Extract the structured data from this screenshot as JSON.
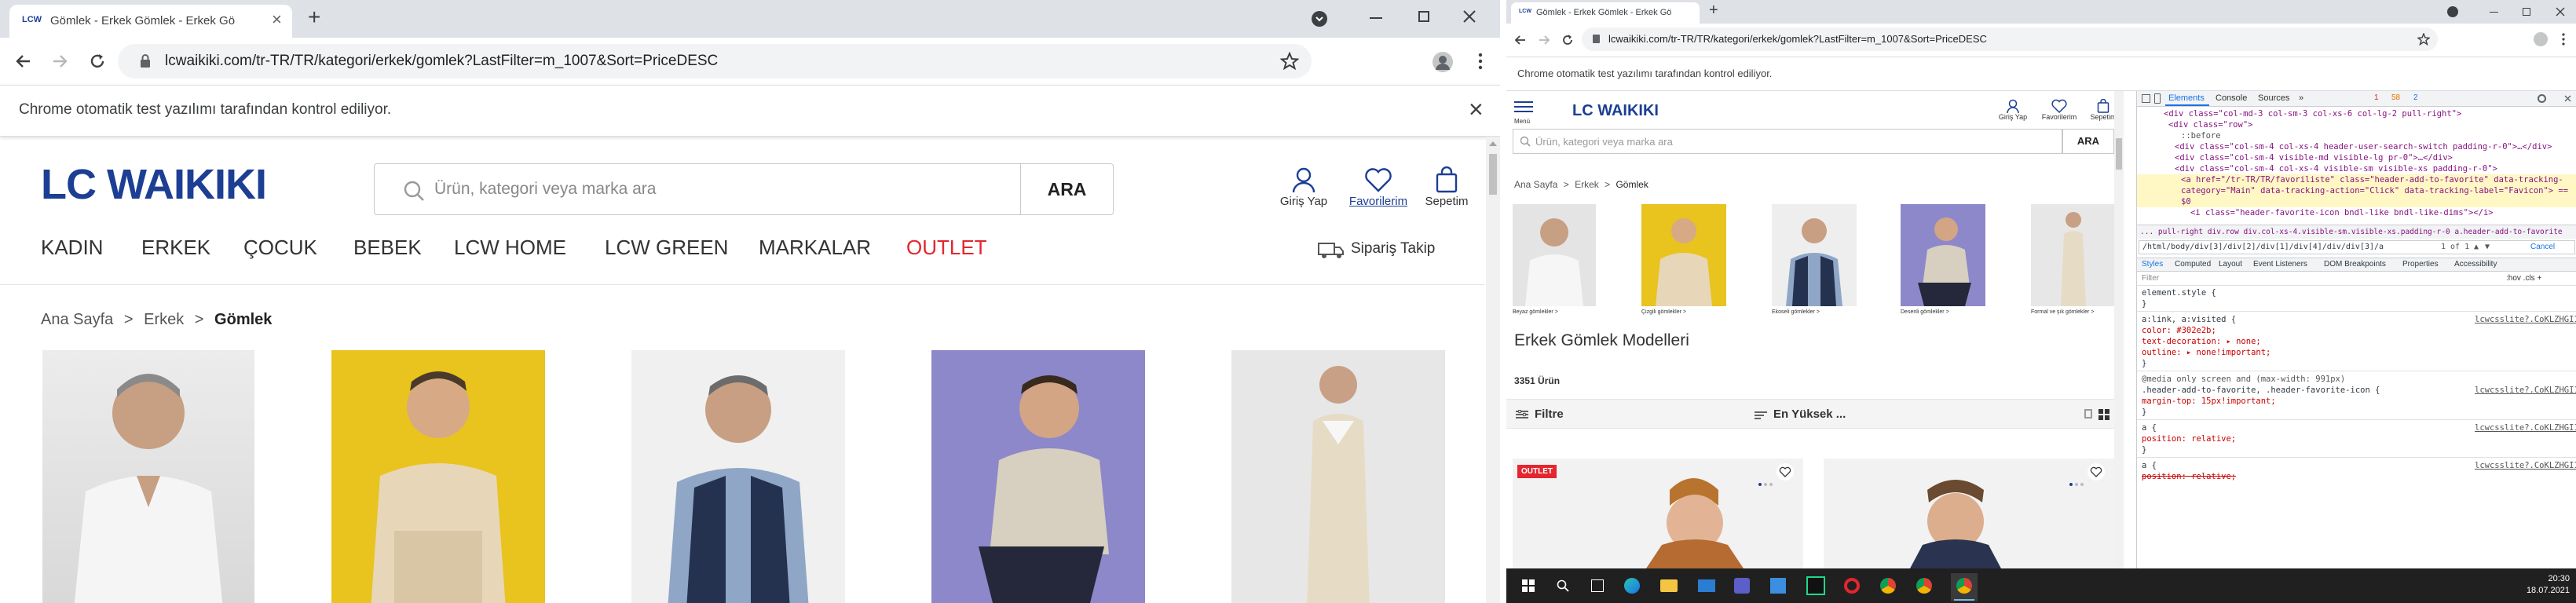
{
  "left_browser": {
    "tab_title": "Gömlek - Erkek Gömlek - Erkek Gö",
    "favicon_text": "LCW",
    "new_tab_symbol": "+",
    "url": "lcwaikiki.com/tr-TR/TR/kategori/erkek/gomlek?LastFilter=m_1007&Sort=PriceDESC",
    "infobar_text": "Chrome otomatik test yazılımı tarafından kontrol ediliyor.",
    "close_symbol": "×"
  },
  "left_page": {
    "logo": "LC WAIKIKI",
    "search_placeholder": "Ürün, kategori veya marka ara",
    "search_button": "ARA",
    "header_icons": [
      {
        "label": "Giriş Yap",
        "icon": "user-icon"
      },
      {
        "label": "Favorilerim",
        "icon": "heart-icon"
      },
      {
        "label": "Sepetim",
        "icon": "bag-icon"
      }
    ],
    "nav": [
      "KADIN",
      "ERKEK",
      "ÇOCUK",
      "BEBEK",
      "LCW HOME",
      "LCW GREEN",
      "MARKALAR",
      "OUTLET"
    ],
    "order_track": "Sipariş Takip",
    "breadcrumb": [
      "Ana Sayfa",
      ">",
      "Erkek",
      ">",
      "Gömlek"
    ],
    "accent_red": "#e3262f",
    "brand_blue": "#1c3f94"
  },
  "right_browser": {
    "tab_title": "Gömlek - Erkek Gömlek - Erkek Gö",
    "favicon_text": "LCW",
    "new_tab_symbol": "+",
    "url": "lcwaikiki.com/tr-TR/TR/kategori/erkek/gomlek?LastFilter=m_1007&Sort=PriceDESC",
    "infobar_text": "Chrome otomatik test yazılımı tarafından kontrol ediliyor."
  },
  "right_page": {
    "menu_label": "Menü",
    "logo": "LC WAIKIKI",
    "header_icons": [
      "Giriş Yap",
      "Favorilerim",
      "Sepetim"
    ],
    "search_placeholder": "Ürün, kategori veya marka ara",
    "search_button": "ARA",
    "breadcrumb": [
      "Ana Sayfa",
      ">",
      "Erkek",
      ">",
      "Gömlek"
    ],
    "category_thumbs": [
      "Beyaz gömlekler >",
      "Çizgili gömlekler >",
      "Ekoseli gömlekler >",
      "Desenli gömlekler >",
      "Formal ve şık gömlekler >"
    ],
    "heading": "Erkek Gömlek Modelleri",
    "count": "3351 Ürün",
    "filter": "Filtre",
    "sort": "En Yüksek ...",
    "outlet_badge": "OUTLET"
  },
  "devtools": {
    "tabs": [
      "Elements",
      "Console",
      "Sources",
      "»"
    ],
    "badges": [
      "1",
      "58",
      "2"
    ],
    "dom_lines": [
      "<div class=\"col-md-3 col-sm-3 col-xs-6 col-lg-2 pull-right\">",
      "<div class=\"row\">",
      "::before",
      "<div class=\"col-sm-4 col-xs-4 header-user-search-switch padding-r-0\">…</div>",
      "<div class=\"col-sm-4 visible-md visible-lg pr-0\">…</div>",
      "<div class=\"col-sm-4 col-xs-4 visible-sm visible-xs padding-r-0\">",
      "<a href=\"/tr-TR/TR/favoriliste\" class=\"header-add-to-favorite\" data-tracking-category=\"Main\" data-tracking-action=\"Click\" data-tracking-label=\"Favicon\"> == $0",
      "<i class=\"header-favorite-icon bndl-like bndl-like-dims\"></i>"
    ],
    "crumbs": "... pull-right   div.row   div.col-xs-4.visible-sm.visible-xs.padding-r-0   a.header-add-to-favorite",
    "xpath": "/html/body/div[3]/div[2]/div[1]/div[4]/div/div[3]/a",
    "match": "1 of 1",
    "cancel": "Cancel",
    "style_tabs": [
      "Styles",
      "Computed",
      "Layout",
      "Event Listeners",
      "DOM Breakpoints",
      "Properties",
      "Accessibility"
    ],
    "filter_placeholder": "Filter",
    "filter_tools": ":hov  .cls  +",
    "css_lines": [
      {
        "t": "element.style {",
        "r": ""
      },
      {
        "t": "}",
        "r": ""
      },
      {
        "t": "a:link, a:visited {",
        "r": "lcwcsslite?.CoKLZHGI1:1"
      },
      {
        "t": "  color: #302e2b;",
        "r": ""
      },
      {
        "t": "  text-decoration: ▸ none;",
        "r": ""
      },
      {
        "t": "  outline: ▸ none!important;",
        "r": ""
      },
      {
        "t": "}",
        "r": ""
      },
      {
        "t": "@media only screen and (max-width: 991px)",
        "r": ""
      },
      {
        "t": ".header-add-to-favorite, .header-favorite-icon {",
        "r": "lcwcsslite?.CoKLZHGI1:1"
      },
      {
        "t": "  margin-top: 15px!important;",
        "r": ""
      },
      {
        "t": "}",
        "r": ""
      },
      {
        "t": "a {",
        "r": "lcwcsslite?.CoKLZHGI1:1"
      },
      {
        "t": "  position: relative;",
        "r": ""
      },
      {
        "t": "}",
        "r": ""
      },
      {
        "t": "a {",
        "r": "lcwcsslite?.CoKLZHGI1:1"
      },
      {
        "t": "  position: relative;",
        "r": ""
      }
    ]
  },
  "taskbar": {
    "time": "20:30",
    "date": "18.07.2021"
  }
}
